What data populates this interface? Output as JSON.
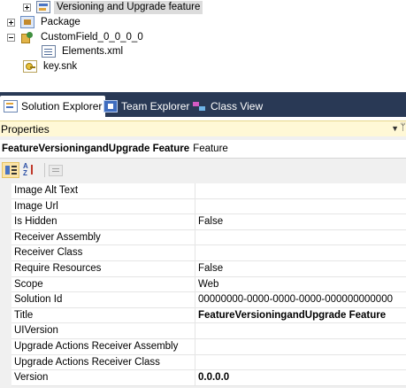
{
  "solution_tree": {
    "items": [
      {
        "label": "Versioning and Upgrade feature",
        "selected": true,
        "expander": "plus",
        "icon": "feature-icon"
      },
      {
        "label": "Package",
        "selected": false,
        "expander": "plus",
        "icon": "package-icon"
      },
      {
        "label": "CustomField_0_0_0_0",
        "selected": false,
        "expander": "minus",
        "icon": "custom-field-icon"
      },
      {
        "label": "Elements.xml",
        "selected": false,
        "expander": "none",
        "icon": "xml-file-icon"
      },
      {
        "label": "key.snk",
        "selected": false,
        "expander": "none",
        "icon": "key-file-icon"
      }
    ]
  },
  "tabs": [
    {
      "label": "Solution Explorer",
      "active": true,
      "icon": "solution-explorer-icon"
    },
    {
      "label": "Team Explorer",
      "active": false,
      "icon": "team-explorer-icon"
    },
    {
      "label": "Class View",
      "active": false,
      "icon": "class-view-icon"
    }
  ],
  "properties": {
    "title": "Properties",
    "dropdown_glyph": "▼",
    "pin_glyph": "ᛘ",
    "object_name": "FeatureVersioningandUpgrade Feature",
    "object_type": "Feature",
    "rows": [
      {
        "name": "Image Alt Text",
        "value": "",
        "bold": false
      },
      {
        "name": "Image Url",
        "value": "",
        "bold": false
      },
      {
        "name": "Is Hidden",
        "value": "False",
        "bold": false
      },
      {
        "name": "Receiver Assembly",
        "value": "",
        "bold": false
      },
      {
        "name": "Receiver Class",
        "value": "",
        "bold": false
      },
      {
        "name": "Require Resources",
        "value": "False",
        "bold": false
      },
      {
        "name": "Scope",
        "value": "Web",
        "bold": false
      },
      {
        "name": "Solution Id",
        "value": "00000000-0000-0000-0000-000000000000",
        "bold": false
      },
      {
        "name": "Title",
        "value": "FeatureVersioningandUpgrade Feature",
        "bold": true
      },
      {
        "name": "UIVersion",
        "value": "",
        "bold": false
      },
      {
        "name": "Upgrade Actions Receiver Assembly",
        "value": "",
        "bold": false
      },
      {
        "name": "Upgrade Actions Receiver Class",
        "value": "",
        "bold": false
      },
      {
        "name": "Version",
        "value": "0.0.0.0",
        "bold": true
      }
    ]
  },
  "colors": {
    "tabbar_bg": "#293955",
    "properties_header_bg": "#fff8d6",
    "selected_tree_bg": "#dcdcdc"
  }
}
